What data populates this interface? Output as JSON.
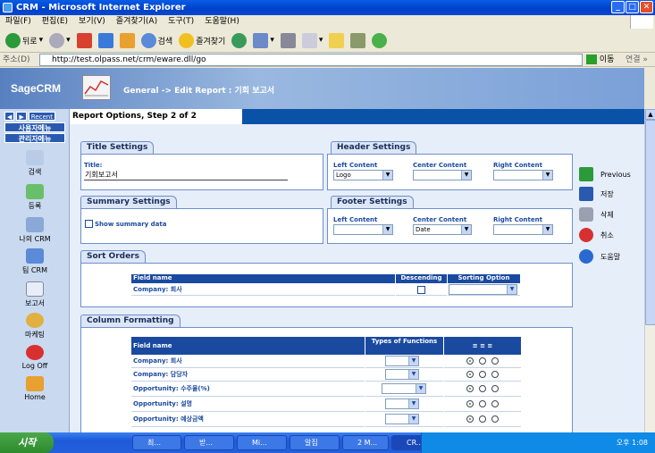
{
  "window": {
    "title": "CRM    - Microsoft Internet Explorer"
  },
  "menu": [
    "파일(F)",
    "편집(E)",
    "보기(V)",
    "즐겨찾기(A)",
    "도구(T)",
    "도움말(H)"
  ],
  "toolbar": {
    "back": "뒤로",
    "search": "검색",
    "favorites": "즐겨찾기"
  },
  "address": {
    "label": "주소(D)",
    "url": "http://test.olpass.net/crm/eware.dll/go",
    "go": "이동",
    "links": "연결 »"
  },
  "crm": {
    "logo": "SageCRM",
    "breadcrumb": "General -> Edit Report : 기회 보고서",
    "step_title": "Report Options, Step 2 of 2"
  },
  "nav": {
    "recent": "Recent",
    "user_menu": "사용자메뉴",
    "admin_menu": "관리자메뉴",
    "items": [
      "검색",
      "등록",
      "나의 CRM",
      "팀 CRM",
      "보고서",
      "마케팅",
      "Log Off",
      "Home"
    ]
  },
  "title_settings": {
    "heading": "Title Settings",
    "title_label": "Title:",
    "title_value": "기회보고서"
  },
  "header_settings": {
    "heading": "Header Settings",
    "left_label": "Left Content",
    "left_value": "Logo",
    "center_label": "Center Content",
    "center_value": "",
    "right_label": "Right Content",
    "right_value": ""
  },
  "summary_settings": {
    "heading": "Summary Settings",
    "show_summary": "Show summary data"
  },
  "footer_settings": {
    "heading": "Footer Settings",
    "left_label": "Left Content",
    "left_value": "",
    "center_label": "Center Content",
    "center_value": "Date",
    "right_label": "Right Content",
    "right_value": ""
  },
  "sort_orders": {
    "heading": "Sort Orders",
    "columns": [
      "Field name",
      "Descending",
      "Sorting Option"
    ],
    "rows": [
      {
        "field": "Company: 회사"
      }
    ]
  },
  "column_formatting": {
    "heading": "Column Formatting",
    "columns": [
      "Field name",
      "Types of Functions"
    ],
    "rows": [
      {
        "field": "Company: 회사"
      },
      {
        "field": "Company: 담당자"
      },
      {
        "field": "Opportunity: 수주율(%)"
      },
      {
        "field": "Opportunity: 설명"
      },
      {
        "field": "Opportunity: 예상금액"
      }
    ]
  },
  "actions": [
    "Previous",
    "저장",
    "삭제",
    "취소",
    "도움말"
  ],
  "taskbar": {
    "start": "시작",
    "tasks": [
      "최...",
      "받...",
      "Mi...",
      "알집",
      "2 M...",
      "CR..."
    ],
    "clock": "오후 1:08"
  }
}
